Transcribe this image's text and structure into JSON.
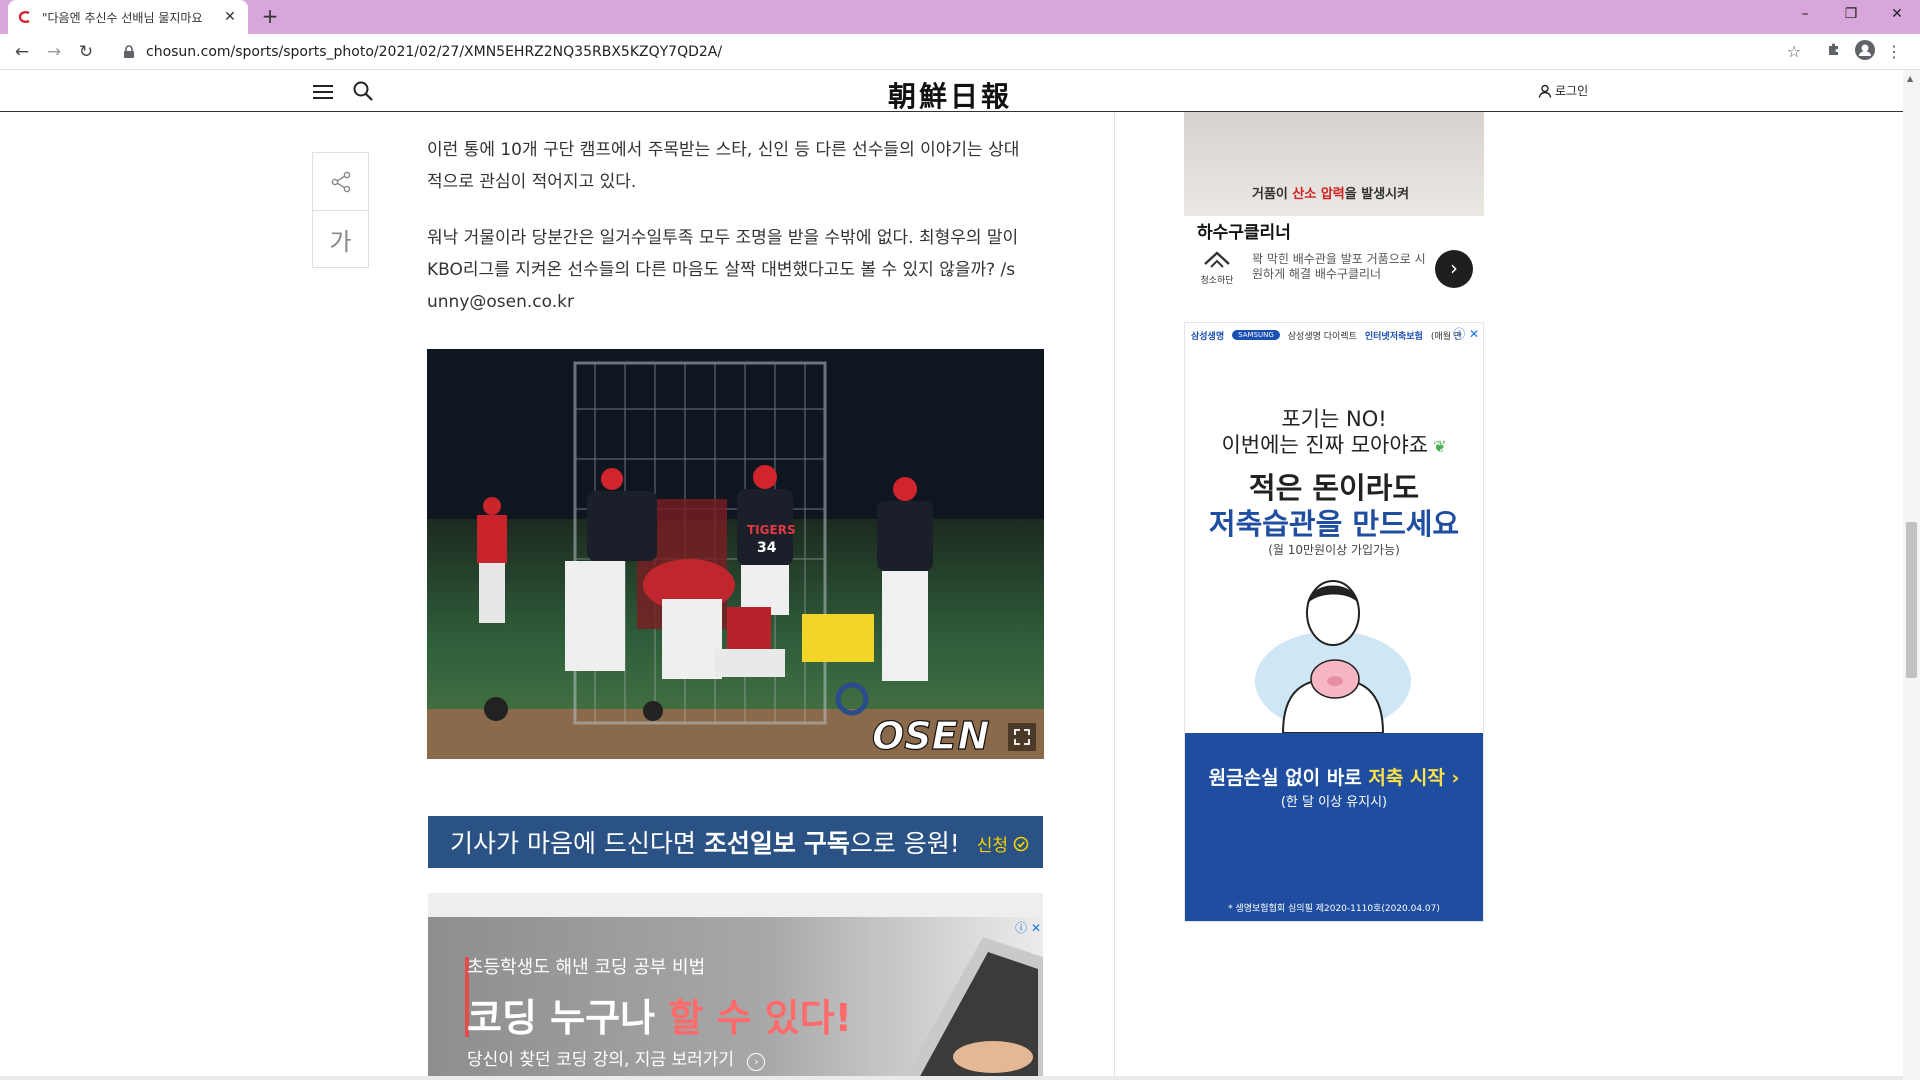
{
  "browser": {
    "tab_title": "\"다음엔 추신수 선배님 물지마요",
    "new_tab": "+",
    "url": "chosun.com/sports/sports_photo/2021/02/27/XMN5EHRZ2NQ35RBX5KZQY7QD2A/",
    "window_controls": {
      "minimize": "–",
      "restore": "❐",
      "close": "✕"
    }
  },
  "site": {
    "logo": "朝鮮日報",
    "login_label": "로그인"
  },
  "article": {
    "font_size_button": "가",
    "paragraphs": [
      {
        "line1": "이런 통에 10개 구단 캠프에서 주목받는 스타, 신인 등 다른 선수들의 이야기는 상대",
        "line2": "적으로 관심이 적어지고 있다."
      },
      {
        "line1": "워낙 거물이라 당분간은 일거수일투족 모두 조명을 받을 수밖에 없다. 최형우의 말이",
        "line2": "KBO리그를 지켜온 선수들의 다른 마음도 살짝 대변했다고도 볼 수 있지 않을까? /s",
        "line3": "unny@osen.co.kr"
      }
    ],
    "photo": {
      "watermark": "OSEN",
      "jersey_team": "TIGERS",
      "jersey_number": "34"
    },
    "subscribe_banner": {
      "text_pre": "기사가 마음에 드신다면 ",
      "text_strong1": "조선일보",
      "text_strong2": "구독",
      "text_post": "으로 응원!",
      "apply": "신청"
    }
  },
  "ads": {
    "coding": {
      "sub": "초등학생도 해낸 코딩 공부 비법",
      "head_a": "코딩 누구나 ",
      "head_b": "할 수 있다!",
      "cta": "당신이 찾던 코딩 강의, 지금 보러가기"
    },
    "drain": {
      "caption_a": "거품이 ",
      "caption_b": "산소 압력",
      "caption_c": "을 발생시켜",
      "brand": "하수구클리너",
      "logo_text": "청소하단",
      "desc": "꽉 막힌 배수관을 발포 거품으로 시원하게 해결 배수구클리너"
    },
    "samsung": {
      "strip_brand": "삼성생명",
      "strip_logo": "SAMSUNG",
      "strip_direct": "삼성생명 다이렉트",
      "strip_insurance": "인터넷저축보험",
      "strip_product": "(매월 만",
      "line1": "포기는 NO!",
      "line2": "이번에는 진짜 모아야죠",
      "big1": "적은 돈이라도",
      "big2": "저축습관을 만드세요",
      "small": "(월 10만원이상 가입가능)",
      "cta_a": "원금손실 없이 바로 ",
      "cta_b": "저축 시작 ›",
      "cta_sub": "(한 달 이상 유지시)",
      "note": "* 생명보험협회 심의필 제2020-1110호(2020.04.07)"
    }
  }
}
